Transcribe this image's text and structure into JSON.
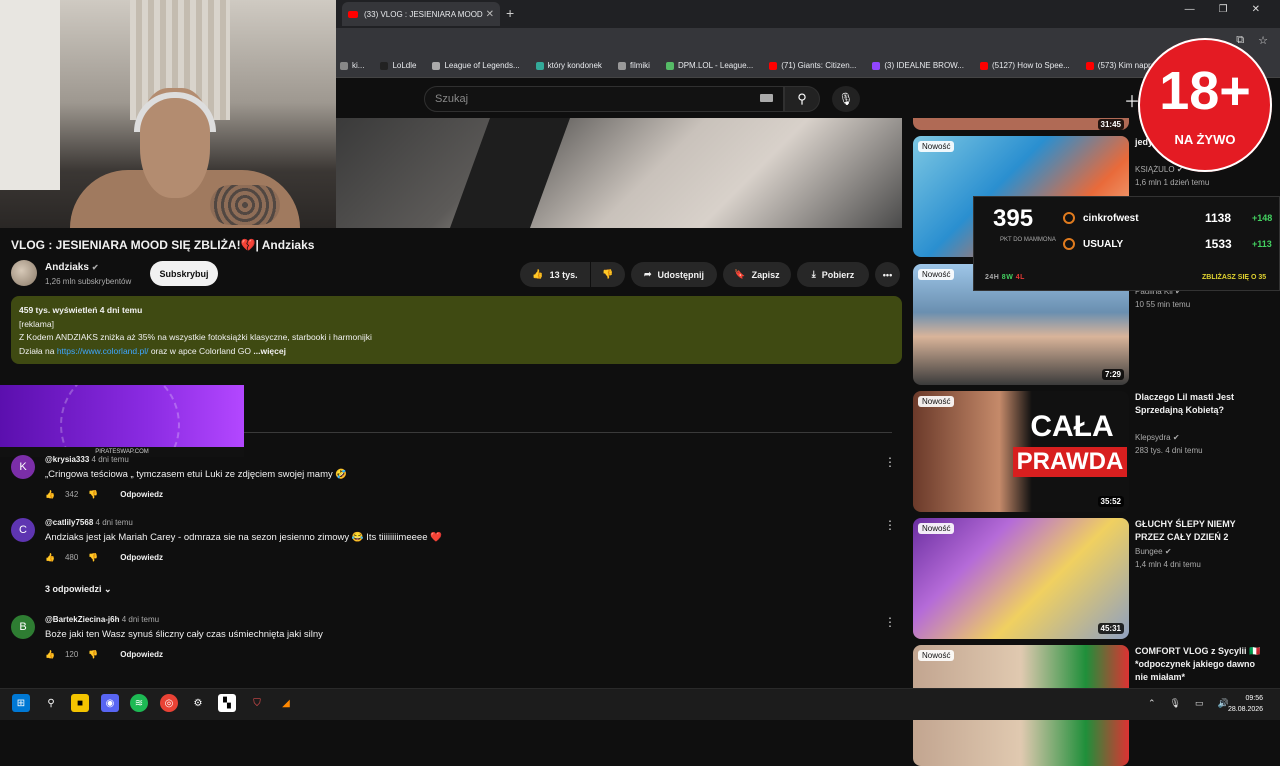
{
  "browser": {
    "tab_title": "(33) VLOG : JESIENIARA MOOD",
    "new_tab": "+",
    "bookmarks": [
      {
        "label": "ki...",
        "color": "#888"
      },
      {
        "label": "LoLdle",
        "color": "#222"
      },
      {
        "label": "League of Legends...",
        "color": "#aaa"
      },
      {
        "label": "który kondonek",
        "color": "#3a9"
      },
      {
        "label": "filmiki",
        "color": "#999"
      },
      {
        "label": "DPM.LOL - League...",
        "color": "#5b6"
      },
      {
        "label": "(71) Giants: Citizen...",
        "color": "#f00"
      },
      {
        "label": "(3) IDEALNE BROW...",
        "color": "#9146ff"
      },
      {
        "label": "(5127) How to Spee...",
        "color": "#f00"
      },
      {
        "label": "(573) Kim naprawdę...",
        "color": "#f00"
      }
    ]
  },
  "youtube": {
    "search_placeholder": "Szukaj",
    "video_title": "VLOG : JESIENIARA MOOD SIĘ ZBLIŻA!💔| Andziaks",
    "channel": "Andziaks",
    "subscribers": "1,26 mln subskrybentów",
    "subscribe": "Subskrybuj",
    "likes": "13 tys.",
    "share": "Udostępnij",
    "save": "Zapisz",
    "download": "Pobierz",
    "description": {
      "meta": "459 tys. wyświetleń  4 dni temu",
      "line1": "[reklama]",
      "line2": "Z Kodem ANDZIAKS zniżka aż 35% na wszystkie fotoksiążki klasyczne, starbooki i harmonijki",
      "line3_prefix": "Działa na ",
      "link": "https://www.colorland.pl/",
      "line3_suffix": " oraz w apce Colorland GO",
      "more": "...więcej"
    },
    "promo_label": "PIRATESWAP.COM",
    "comments": [
      {
        "initial": "K",
        "color": "#7b2ea8",
        "handle": "@krysia333",
        "time": "4 dni temu",
        "text": "„Cringowa teściowa „ tymczasem etui Luki ze zdjęciem swojej mamy 🤣",
        "likes": "342",
        "reply": "Odpowiedz"
      },
      {
        "initial": "C",
        "color": "#5e35b1",
        "handle": "@catlily7568",
        "time": "4 dni temu",
        "text": "Andziaks jest jak Mariah Carey - odmraza sie na sezon jesienno zimowy 😂 Its tiiiiiiiimeeee ❤️",
        "likes": "480",
        "reply": "Odpowiedz"
      },
      {
        "initial": "B",
        "color": "#2e7d32",
        "handle": "@BartekZiecina-j6h",
        "time": "4 dni temu",
        "text": "Boże jaki ten Wasz synuś śliczny cały czas uśmiechnięta jaki silny",
        "likes": "120",
        "reply": "Odpowiedz"
      }
    ],
    "replies": "3 odpowiedzi",
    "sidebar": [
      {
        "title": "jedy... POLSCE... zwróciło)",
        "channel": "KSIĄŻULO",
        "meta": "1,6 mln  1 dzień temu",
        "duration": "",
        "new": "Nowość"
      },
      {
        "title": "",
        "channel": "Paulina Kil",
        "meta": "10  55 min temu",
        "duration": "7:29",
        "new": "Nowość"
      },
      {
        "title": "Dlaczego Lil masti Jest Sprzedajną Kobietą?",
        "channel": "Klepsydra",
        "meta": "283 tys.  4 dni temu",
        "duration": "35:52",
        "new": "Nowość",
        "thumb_text1": "CAŁA",
        "thumb_text2": "PRAWDA"
      },
      {
        "title": "GŁUCHY ŚLEPY NIEMY PRZEZ CAŁY DZIEŃ 2",
        "channel": "Bungee",
        "meta": "1,4 mln  4 dni temu",
        "duration": "45:31",
        "new": "Nowość"
      },
      {
        "title": "COMFORT VLOG z Sycylii 🇮🇹 *odpoczynek jakiego dawno nie miałam*",
        "channel": "",
        "meta": "",
        "duration": "",
        "new": "Nowość"
      }
    ],
    "top_duration": "31:45"
  },
  "points_widget": {
    "points": "395",
    "points_label": "PKT DO MAMMONA",
    "rows": [
      {
        "name": "cinkrofwest",
        "rank": "5",
        "value": "1138",
        "delta": "+148"
      },
      {
        "name": "USUALY",
        "rank": "6",
        "value": "1533",
        "delta": "+113"
      }
    ],
    "foot_prefix": "24H",
    "wins": "8W",
    "losses": "4L",
    "foot_right": "ZBLIŻASZ SIĘ O 35"
  },
  "badge": {
    "big": "18+",
    "small": "NA ŻYWO"
  },
  "taskbar": {
    "time": "09:56",
    "date": "28.08.2026"
  },
  "colors": {
    "description_bg": "#3f4a12",
    "accent_green": "#43d160",
    "badge_red": "#e41b23",
    "link": "#3ea6ff"
  }
}
